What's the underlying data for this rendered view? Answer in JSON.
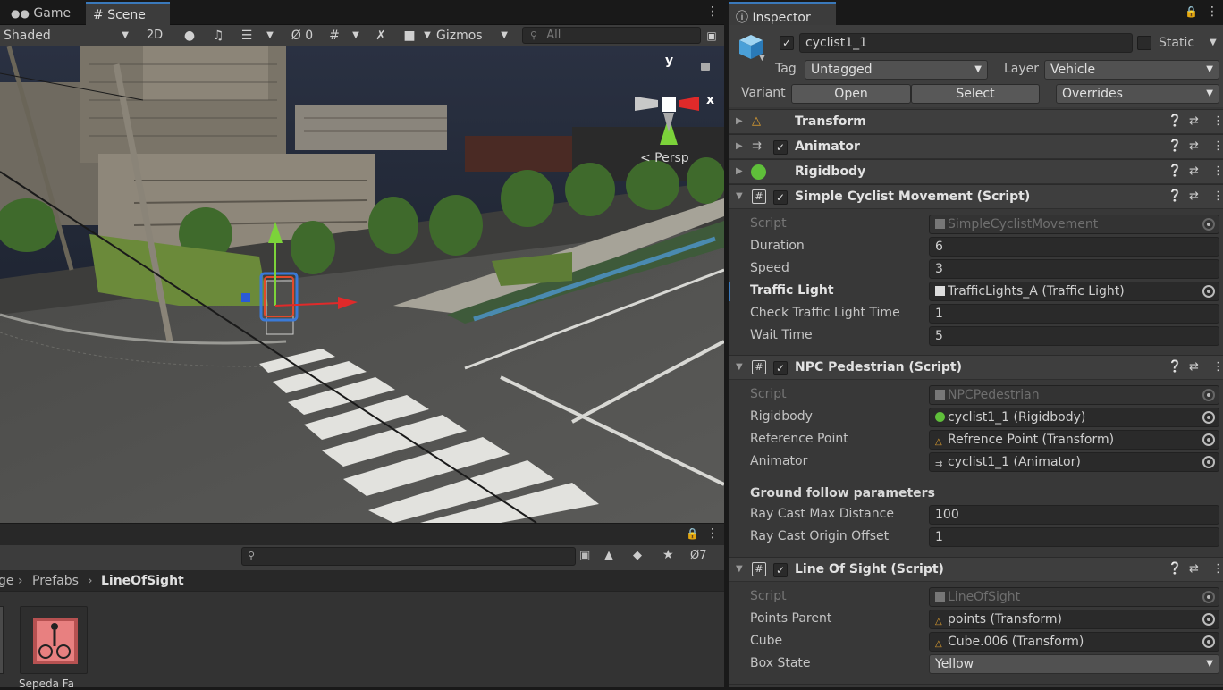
{
  "left_tabs": {
    "game": "Game",
    "scene": "Scene"
  },
  "scene_toolbar": {
    "draw_mode": "Shaded",
    "mode_2d": "2D",
    "hidden_count": "0",
    "gizmos": "Gizmos",
    "search_placeholder": "All"
  },
  "scene_view": {
    "axis_y": "y",
    "axis_x": "x",
    "projection": "< Persp"
  },
  "project_toolbar": {
    "hidden_count": "7"
  },
  "breadcrumb": {
    "items": [
      "ge",
      "Prefabs"
    ],
    "current": "LineOfSight"
  },
  "assets": [
    {
      "name": "Sepeda Fa"
    }
  ],
  "inspector": {
    "tab": "Inspector",
    "object_name": "cyclist1_1",
    "static_label": "Static",
    "tag_label": "Tag",
    "tag_value": "Untagged",
    "layer_label": "Layer",
    "layer_value": "Vehicle",
    "variant_label": "Variant",
    "open_btn": "Open",
    "select_btn": "Select",
    "overrides": "Overrides",
    "components": {
      "transform": "Transform",
      "animator": "Animator",
      "rigidbody": "Rigidbody",
      "scm": {
        "title": "Simple Cyclist Movement (Script)",
        "script_label": "Script",
        "script_value": "SimpleCyclistMovement",
        "duration_label": "Duration",
        "duration_value": "6",
        "speed_label": "Speed",
        "speed_value": "3",
        "traffic_light_label": "Traffic Light",
        "traffic_light_value": "TrafficLights_A (Traffic Light)",
        "check_label": "Check Traffic Light Time",
        "check_value": "1",
        "wait_label": "Wait Time",
        "wait_value": "5"
      },
      "npc": {
        "title": "NPC Pedestrian (Script)",
        "script_label": "Script",
        "script_value": "NPCPedestrian",
        "rigidbody_label": "Rigidbody",
        "rigidbody_value": "cyclist1_1 (Rigidbody)",
        "ref_label": "Reference Point",
        "ref_value": "Refrence Point (Transform)",
        "animator_label": "Animator",
        "animator_value": "cyclist1_1 (Animator)",
        "ground_header": "Ground follow parameters",
        "ray_dist_label": "Ray Cast Max Distance",
        "ray_dist_value": "100",
        "ray_off_label": "Ray Cast Origin Offset",
        "ray_off_value": "1"
      },
      "los": {
        "title": "Line Of Sight (Script)",
        "script_label": "Script",
        "script_value": "LineOfSight",
        "points_label": "Points Parent",
        "points_value": "points (Transform)",
        "cube_label": "Cube",
        "cube_value": "Cube.006 (Transform)",
        "box_label": "Box State",
        "box_value": "Yellow"
      }
    }
  },
  "colors": {
    "accent": "#3a79bb",
    "gizmo_y": "#7cd33a",
    "gizmo_x": "#e02a2a",
    "selection": "#f08a2a"
  }
}
